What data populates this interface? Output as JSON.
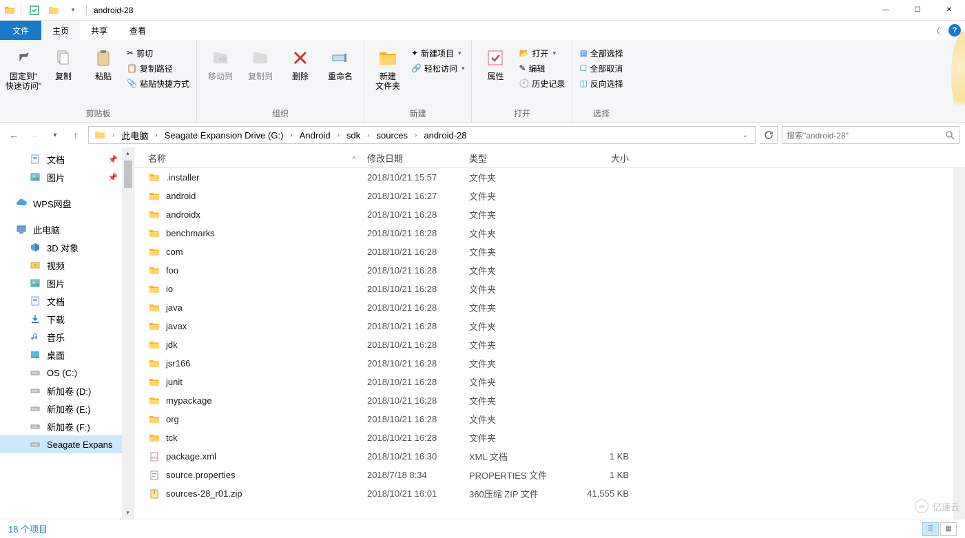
{
  "window": {
    "title": "android-28",
    "min": "—",
    "max": "☐",
    "close": "✕"
  },
  "ribbon_tabs": {
    "file": "文件",
    "home": "主页",
    "share": "共享",
    "view": "查看"
  },
  "ribbon": {
    "clipboard": {
      "label": "剪贴板",
      "pin": "固定到\"\n快速访问\"",
      "copy": "复制",
      "paste": "粘贴",
      "cut": "剪切",
      "copypath": "复制路径",
      "pasteshortcut": "粘贴快捷方式"
    },
    "organize": {
      "label": "组织",
      "moveto": "移动到",
      "copyto": "复制到",
      "delete": "删除",
      "rename": "重命名"
    },
    "new": {
      "label": "新建",
      "newfolder": "新建\n文件夹",
      "newitem": "新建项目",
      "easyaccess": "轻松访问"
    },
    "open": {
      "label": "打开",
      "properties": "属性",
      "open": "打开",
      "edit": "编辑",
      "history": "历史记录"
    },
    "select": {
      "label": "选择",
      "all": "全部选择",
      "none": "全部取消",
      "invert": "反向选择"
    }
  },
  "breadcrumbs": [
    "此电脑",
    "Seagate Expansion Drive (G:)",
    "Android",
    "sdk",
    "sources",
    "android-28"
  ],
  "search_placeholder": "搜索\"android-28\"",
  "sidebar": {
    "items": [
      {
        "label": "文档",
        "icon": "doc",
        "lvl": 2,
        "pin": true
      },
      {
        "label": "图片",
        "icon": "pic",
        "lvl": 2,
        "pin": true
      },
      {
        "spacer": true
      },
      {
        "label": "WPS网盘",
        "icon": "cloud",
        "lvl": 1
      },
      {
        "spacer": true
      },
      {
        "label": "此电脑",
        "icon": "pc",
        "lvl": 1
      },
      {
        "label": "3D 对象",
        "icon": "3d",
        "lvl": 2
      },
      {
        "label": "视频",
        "icon": "vid",
        "lvl": 2
      },
      {
        "label": "图片",
        "icon": "pic",
        "lvl": 2
      },
      {
        "label": "文档",
        "icon": "doc",
        "lvl": 2
      },
      {
        "label": "下载",
        "icon": "dl",
        "lvl": 2
      },
      {
        "label": "音乐",
        "icon": "mus",
        "lvl": 2
      },
      {
        "label": "桌面",
        "icon": "desk",
        "lvl": 2
      },
      {
        "label": "OS (C:)",
        "icon": "drive",
        "lvl": 2
      },
      {
        "label": "新加卷 (D:)",
        "icon": "drive",
        "lvl": 2
      },
      {
        "label": "新加卷 (E:)",
        "icon": "drive",
        "lvl": 2
      },
      {
        "label": "新加卷 (F:)",
        "icon": "drive",
        "lvl": 2
      },
      {
        "label": "Seagate Expans",
        "icon": "drive",
        "lvl": 2,
        "selected": true
      }
    ]
  },
  "columns": {
    "name": "名称",
    "date": "修改日期",
    "type": "类型",
    "size": "大小"
  },
  "files": [
    {
      "name": ".installer",
      "date": "2018/10/21 15:57",
      "type": "文件夹",
      "size": "",
      "icon": "folder"
    },
    {
      "name": "android",
      "date": "2018/10/21 16:27",
      "type": "文件夹",
      "size": "",
      "icon": "folder"
    },
    {
      "name": "androidx",
      "date": "2018/10/21 16:28",
      "type": "文件夹",
      "size": "",
      "icon": "folder"
    },
    {
      "name": "benchmarks",
      "date": "2018/10/21 16:28",
      "type": "文件夹",
      "size": "",
      "icon": "folder"
    },
    {
      "name": "com",
      "date": "2018/10/21 16:28",
      "type": "文件夹",
      "size": "",
      "icon": "folder"
    },
    {
      "name": "foo",
      "date": "2018/10/21 16:28",
      "type": "文件夹",
      "size": "",
      "icon": "folder"
    },
    {
      "name": "io",
      "date": "2018/10/21 16:28",
      "type": "文件夹",
      "size": "",
      "icon": "folder"
    },
    {
      "name": "java",
      "date": "2018/10/21 16:28",
      "type": "文件夹",
      "size": "",
      "icon": "folder"
    },
    {
      "name": "javax",
      "date": "2018/10/21 16:28",
      "type": "文件夹",
      "size": "",
      "icon": "folder"
    },
    {
      "name": "jdk",
      "date": "2018/10/21 16:28",
      "type": "文件夹",
      "size": "",
      "icon": "folder"
    },
    {
      "name": "jsr166",
      "date": "2018/10/21 16:28",
      "type": "文件夹",
      "size": "",
      "icon": "folder"
    },
    {
      "name": "junit",
      "date": "2018/10/21 16:28",
      "type": "文件夹",
      "size": "",
      "icon": "folder"
    },
    {
      "name": "mypackage",
      "date": "2018/10/21 16:28",
      "type": "文件夹",
      "size": "",
      "icon": "folder"
    },
    {
      "name": "org",
      "date": "2018/10/21 16:28",
      "type": "文件夹",
      "size": "",
      "icon": "folder"
    },
    {
      "name": "tck",
      "date": "2018/10/21 16:28",
      "type": "文件夹",
      "size": "",
      "icon": "folder"
    },
    {
      "name": "package.xml",
      "date": "2018/10/21 16:30",
      "type": "XML 文档",
      "size": "1 KB",
      "icon": "xml"
    },
    {
      "name": "source.properties",
      "date": "2018/7/18 8:34",
      "type": "PROPERTIES 文件",
      "size": "1 KB",
      "icon": "prop"
    },
    {
      "name": "sources-28_r01.zip",
      "date": "2018/10/21 16:01",
      "type": "360压缩 ZIP 文件",
      "size": "41,555 KB",
      "icon": "zip"
    }
  ],
  "status": "18 个项目",
  "watermark": "亿速云"
}
